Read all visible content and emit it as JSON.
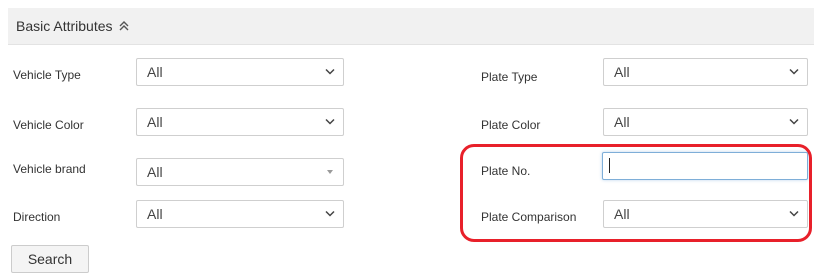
{
  "section": {
    "title": "Basic Attributes",
    "toggle_icon": "double-chevron-up-icon"
  },
  "left_fields": [
    {
      "label": "Vehicle Type",
      "value": "All",
      "arrow_style": "chevron-down-icon"
    },
    {
      "label": "Vehicle Color",
      "value": "All",
      "arrow_style": "chevron-down-icon"
    },
    {
      "label": "Vehicle brand",
      "value": "All",
      "arrow_style": "caret-down-icon"
    },
    {
      "label": "Direction",
      "value": "All",
      "arrow_style": "chevron-down-icon"
    }
  ],
  "right_fields": {
    "plate_type": {
      "label": "Plate Type",
      "value": "All"
    },
    "plate_color": {
      "label": "Plate Color",
      "value": "All"
    },
    "plate_no": {
      "label": "Plate No.",
      "value": ""
    },
    "plate_comparison": {
      "label": "Plate Comparison",
      "value": "All"
    }
  },
  "search_button": {
    "label": "Search"
  },
  "colors": {
    "header_bg": "#f1f1f1",
    "highlight_ring": "#e8202a",
    "input_focus_border": "#7eaed8"
  }
}
